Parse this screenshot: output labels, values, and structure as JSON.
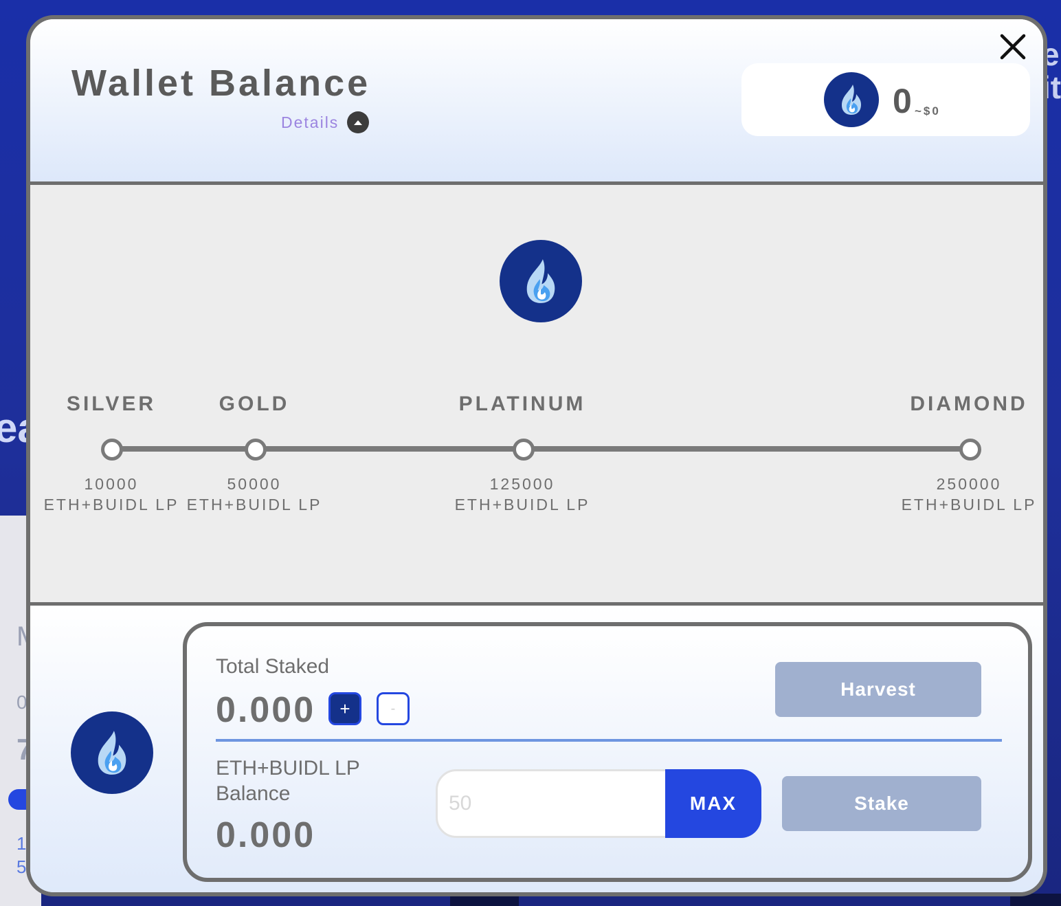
{
  "background": {
    "fragments": [
      "e",
      "it",
      "ea",
      "M",
      "0",
      "7",
      "1",
      "5"
    ]
  },
  "header": {
    "title": "Wallet Balance",
    "details_label": "Details",
    "balance_amount": "0",
    "balance_usd": "~$0"
  },
  "tiers": [
    {
      "name": "SILVER",
      "amount": "10000",
      "unit": "ETH+BUIDL LP"
    },
    {
      "name": "GOLD",
      "amount": "50000",
      "unit": "ETH+BUIDL LP"
    },
    {
      "name": "PLATINUM",
      "amount": "125000",
      "unit": "ETH+BUIDL LP"
    },
    {
      "name": "DIAMOND",
      "amount": "250000",
      "unit": "ETH+BUIDL LP"
    }
  ],
  "staking": {
    "total_staked_label": "Total Staked",
    "total_staked_value": "0.000",
    "plus_label": "+",
    "minus_label": "-",
    "harvest_label": "Harvest",
    "lp_balance_label": "ETH+BUIDL LP Balance",
    "lp_balance_value": "0.000",
    "amount_placeholder": "50",
    "max_label": "MAX",
    "stake_label": "Stake"
  },
  "colors": {
    "brand_blue": "#2447e0",
    "logo_navy": "#14318a",
    "disabled_button": "#a0b0cf",
    "details_purple": "#9b84e0"
  },
  "icons": [
    "flame-logo-icon",
    "close-icon",
    "chevron-up-icon"
  ]
}
